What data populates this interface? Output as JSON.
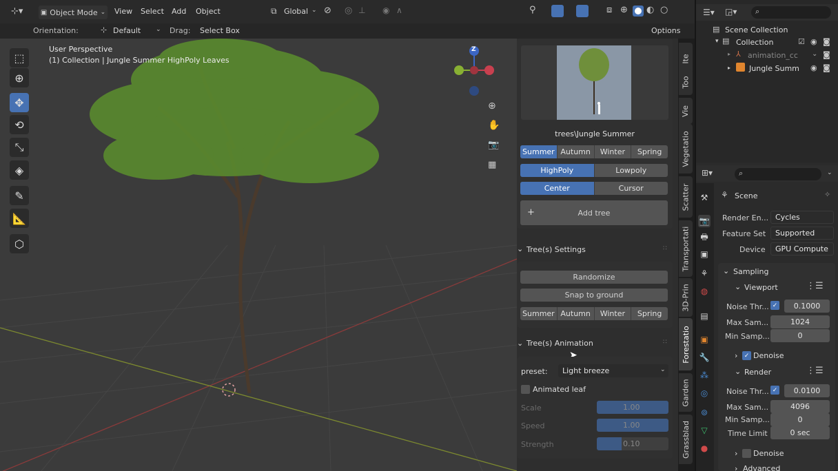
{
  "header": {
    "mode": "Object Mode",
    "menus": [
      "View",
      "Select",
      "Add",
      "Object"
    ],
    "transform": "Global"
  },
  "toolbar2": {
    "orientation_label": "Orientation:",
    "orientation_value": "Default",
    "drag_label": "Drag:",
    "drag_value": "Select Box",
    "options": "Options"
  },
  "viewport": {
    "perspective": "User Perspective",
    "collection_info": "(1) Collection | Jungle Summer HighPoly Leaves",
    "gizmo_z": "Z"
  },
  "addon": {
    "preview_caption": "trees\\Jungle Summer",
    "seasons": [
      "Summer",
      "Autumn",
      "Winter",
      "Spring"
    ],
    "season_selected": "Summer",
    "poly": [
      "HighPoly",
      "Lowpoly"
    ],
    "poly_selected": "HighPoly",
    "placement": [
      "Center",
      "Cursor"
    ],
    "placement_selected": "Center",
    "add_tree": "Add tree",
    "settings_title": "Tree(s) Settings",
    "randomize": "Randomize",
    "snap": "Snap to ground",
    "settings_seasons": [
      "Summer",
      "Autumn",
      "Winter",
      "Spring"
    ],
    "animation_title": "Tree(s) Animation",
    "preset_label": "preset:",
    "preset_value": "Light breeze",
    "animated_leaf": "Animated leaf",
    "sliders": [
      {
        "label": "Scale",
        "value": "1.00"
      },
      {
        "label": "Speed",
        "value": "1.00"
      },
      {
        "label": "Strength",
        "value": "0.10"
      }
    ]
  },
  "side_tabs": [
    "Ite",
    "Too",
    "Vie",
    "Vegetatio",
    "Scatter",
    "Transportati",
    "3D-Prin",
    "Forestatio",
    "Garden",
    "Grassblad"
  ],
  "outliner": {
    "scene_collection": "Scene Collection",
    "items": [
      {
        "label": "Collection"
      },
      {
        "label": "animation_cc"
      },
      {
        "label": "Jungle Summ"
      }
    ]
  },
  "properties": {
    "scene": "Scene",
    "render_engine_label": "Render En...",
    "render_engine": "Cycles",
    "feature_label": "Feature Set",
    "feature": "Supported",
    "device_label": "Device",
    "device": "GPU Compute",
    "sampling": "Sampling",
    "viewport": "Viewport",
    "noise_thr": "Noise Thr...",
    "noise_vp": "0.1000",
    "max_sam": "Max Sam...",
    "max_vp": "1024",
    "min_samp": "Min Samp...",
    "min_vp": "0",
    "denoise": "Denoise",
    "render": "Render",
    "noise_r": "0.0100",
    "max_r": "4096",
    "min_r": "0",
    "time_limit": "Time Limit",
    "time_r": "0 sec",
    "denoise2": "Denoise",
    "advanced": "Advanced"
  }
}
